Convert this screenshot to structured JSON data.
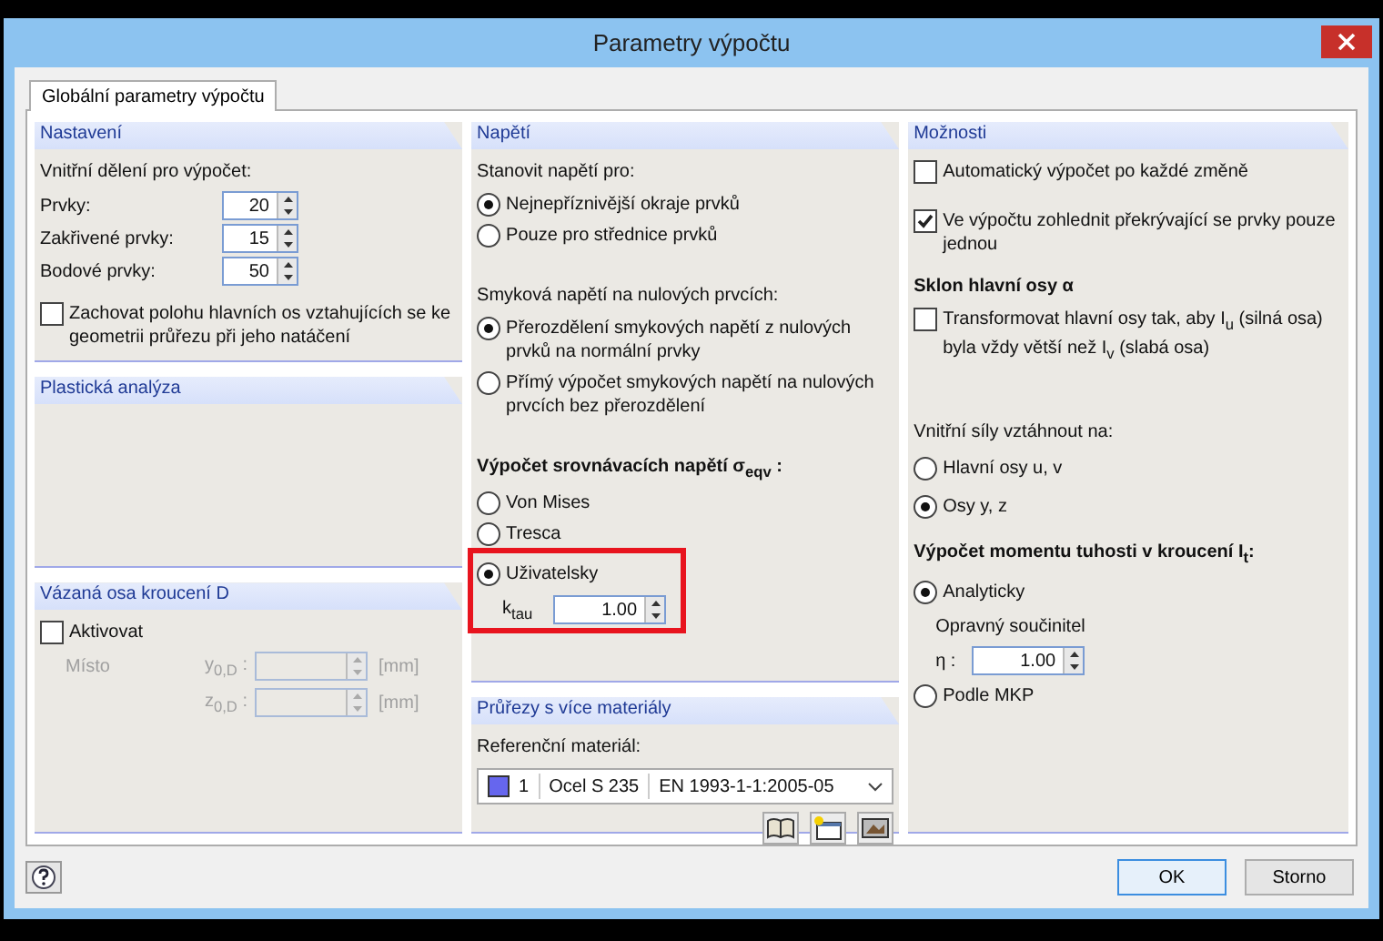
{
  "window": {
    "title": "Parametry výpočtu"
  },
  "tabs": [
    {
      "label": "Globální parametry výpočtu",
      "selected": true
    }
  ],
  "settings": {
    "title": "Nastavení",
    "heading": "Vnitřní dělení pro výpočet:",
    "spinners": [
      {
        "label": "Prvky:",
        "value": "20"
      },
      {
        "label": "Zakřivené prvky:",
        "value": "15"
      },
      {
        "label": "Bodové prvky:",
        "value": "50"
      }
    ],
    "checkbox": {
      "label": "Zachovat polohu hlavních os vztahujících se ke geometrii průřezu při jeho natáčení",
      "checked": false
    }
  },
  "plastic_analysis": {
    "title": "Plastická analýza"
  },
  "torsion_axis": {
    "title": "Vázaná osa kroucení D",
    "checkbox": {
      "label": "Aktivovat",
      "checked": false
    },
    "location_label": "Místo",
    "fields": [
      {
        "label": "y$_{0,D}$ :",
        "unit": "[mm]",
        "disabled": true
      },
      {
        "label": "z$_{0,D}$ :",
        "unit": "[mm]",
        "disabled": true
      }
    ]
  },
  "stresses": {
    "title": "Napětí",
    "groups": [
      {
        "heading": "Stanovit napětí pro:",
        "bold": false,
        "options": [
          {
            "label": "Nejnepříznivější okraje prvků",
            "selected": true
          },
          {
            "label": "Pouze pro střednice prvků",
            "selected": false
          }
        ]
      },
      {
        "heading": "Smyková napětí na nulových prvcích:",
        "bold": false,
        "options": [
          {
            "label": "Přerozdělení smykových napětí z nulových prvků na normální prvky",
            "selected": true
          },
          {
            "label": "Přímý výpočet smykových napětí na nulových prvcích bez přerozdělení",
            "selected": false
          }
        ]
      },
      {
        "heading": "Výpočet srovnávacích napětí σ$_{eqv}$ :",
        "bold": true,
        "options": [
          {
            "label": "Von Mises",
            "selected": false
          },
          {
            "label": "Tresca",
            "selected": false
          },
          {
            "label": "Uživatelsky",
            "selected": true
          }
        ]
      }
    ],
    "custom_factor": {
      "label": "k$_{tau}$",
      "value": "1.00",
      "highlighted": true
    }
  },
  "multi_material": {
    "title": "Průřezy s více materiály",
    "label": "Referenční materiál:",
    "material": {
      "color": "#6666ee",
      "number": "1",
      "name": "Ocel S 235",
      "standard": "EN 1993-1-1:2005-05"
    }
  },
  "options": {
    "title": "Možnosti",
    "checkboxes": [
      {
        "label": "Automatický výpočet po každé změně",
        "checked": false
      },
      {
        "label": "Ve výpočtu zohlednit překrývající se prvky pouze jednou",
        "checked": true
      }
    ],
    "axis_heading": "Sklon hlavní osy α",
    "transform": {
      "label": "Transformovat hlavní osy tak, aby I$_{u}$ (silná osa) byla vždy větší než I$_{v}$ (slabá  osa)",
      "checked": false
    },
    "forces_heading": "Vnitřní síly vztáhnout na:",
    "forces": [
      {
        "label": "Hlavní osy u, v",
        "selected": false
      },
      {
        "label": "Osy y, z",
        "selected": true
      }
    ],
    "torsion_heading": "Výpočet momentu tuhosti v kroucení I$_{t}$:",
    "analytic": {
      "label": "Analyticky",
      "selected": true
    },
    "factor_label": "Opravný součinitel",
    "factor": {
      "label": "η :",
      "value": "1.00"
    },
    "fem": {
      "label": "Podle MKP",
      "selected": false
    }
  },
  "buttons": {
    "ok": "OK",
    "cancel": "Storno"
  }
}
